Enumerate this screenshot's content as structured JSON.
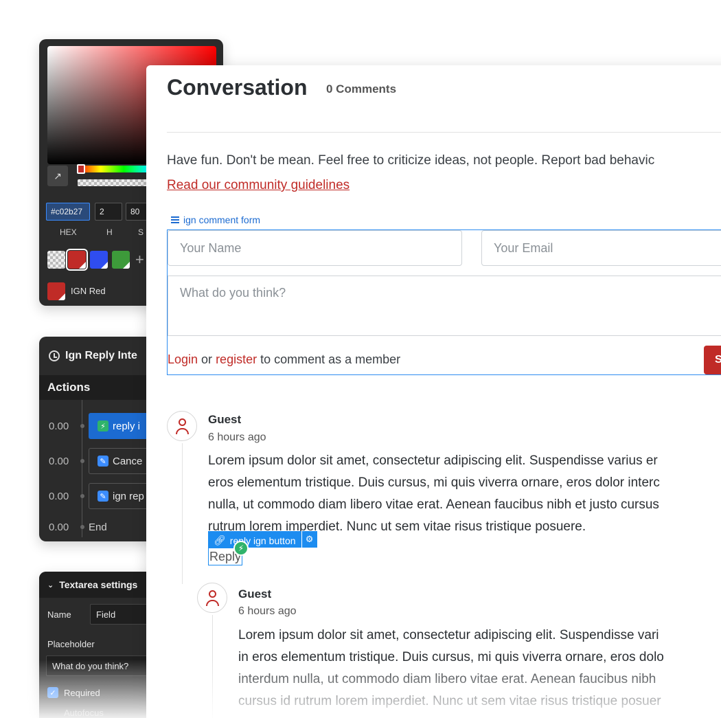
{
  "color_picker": {
    "hex_value": "#c02b27",
    "h_value": "2",
    "s_value": "80",
    "labels": {
      "hex": "HEX",
      "h": "H",
      "s": "S"
    },
    "add_symbol": "+",
    "saved_swatch_name": "IGN Red",
    "colors": {
      "selected": "#c02b27",
      "blue": "#2f4df0",
      "green": "#3d9a3a"
    }
  },
  "interactions": {
    "title": "Ign Reply Inte",
    "actions_label": "Actions",
    "rows": [
      {
        "time": "0.00",
        "label": "reply i",
        "active": true
      },
      {
        "time": "0.00",
        "label": "Cance",
        "active": false
      },
      {
        "time": "0.00",
        "label": "ign rep",
        "active": false
      }
    ],
    "end_time": "0.00",
    "end_label": "End"
  },
  "textarea_settings": {
    "title": "Textarea settings",
    "name_label": "Name",
    "name_value": "Field",
    "placeholder_label": "Placeholder",
    "placeholder_value": "What do you think?",
    "required_label": "Required",
    "autofocus_label": "Autofocus"
  },
  "conversation": {
    "title": "Conversation",
    "count": "0 Comments",
    "intro": "Have fun. Don't be mean. Feel free to criticize ideas, not people. Report bad behavic",
    "guidelines_link": "Read our community guidelines",
    "form_tag": "ign comment form",
    "name_placeholder": "Your Name",
    "email_placeholder": "Your Email",
    "comment_placeholder": "What do you think?",
    "footer": {
      "login": "Login",
      "or": " or ",
      "register": "register",
      "rest": " to comment as a member"
    },
    "submit_label": "S",
    "accent_color": "#c02b27",
    "selection_color": "#1c8cf0"
  },
  "comments": [
    {
      "author": "Guest",
      "time": "6 hours ago",
      "body": "Lorem ipsum dolor sit amet, consectetur adipiscing elit. Suspendisse varius er\neros elementum tristique. Duis cursus, mi quis viverra ornare, eros dolor interc\nnulla, ut commodo diam libero vitae erat. Aenean faucibus nibh et justo cursus\nrutrum lorem imperdiet. Nunc ut sem vitae risus tristique posuere."
    },
    {
      "author": "Guest",
      "time": "6 hours ago",
      "body": "Lorem ipsum dolor sit amet, consectetur adipiscing elit. Suspendisse vari\nin eros elementum tristique. Duis cursus, mi quis viverra ornare, eros dolo\ninterdum nulla, ut commodo diam libero vitae erat. Aenean faucibus nibh\ncursus id rutrum lorem imperdiet. Nunc ut sem vitae risus tristique posuer"
    }
  ],
  "reply": {
    "tag_label": "reply ign button",
    "button_label": "Reply"
  }
}
